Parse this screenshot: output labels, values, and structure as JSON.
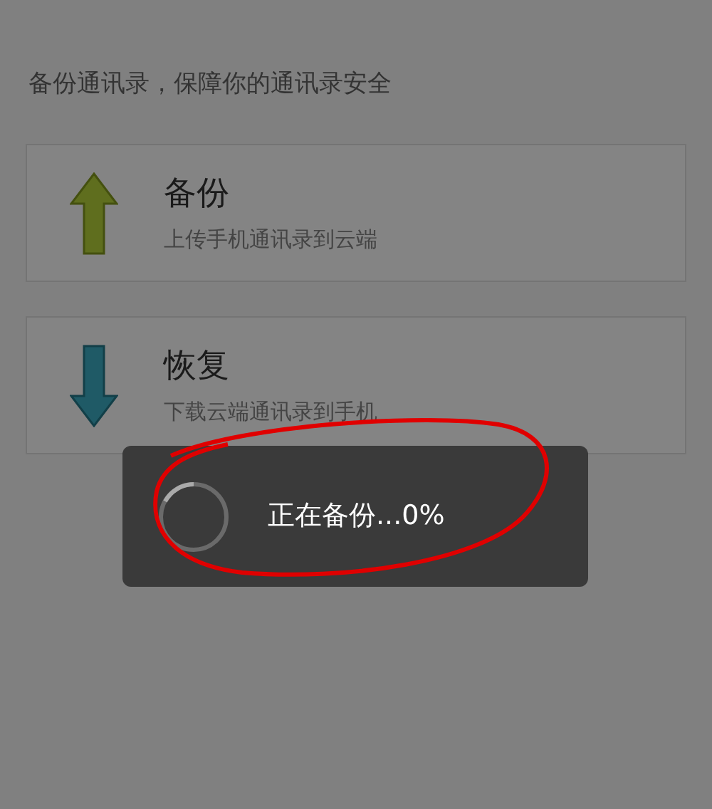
{
  "header": "备份通讯录，保障你的通讯录安全",
  "cards": [
    {
      "kind": "upload",
      "title": "备份",
      "subtitle": "上传手机通讯录到云端"
    },
    {
      "kind": "download",
      "title": "恢复",
      "subtitle": "下载云端通讯录到手机"
    }
  ],
  "dialog": {
    "message": "正在备份...0%"
  }
}
